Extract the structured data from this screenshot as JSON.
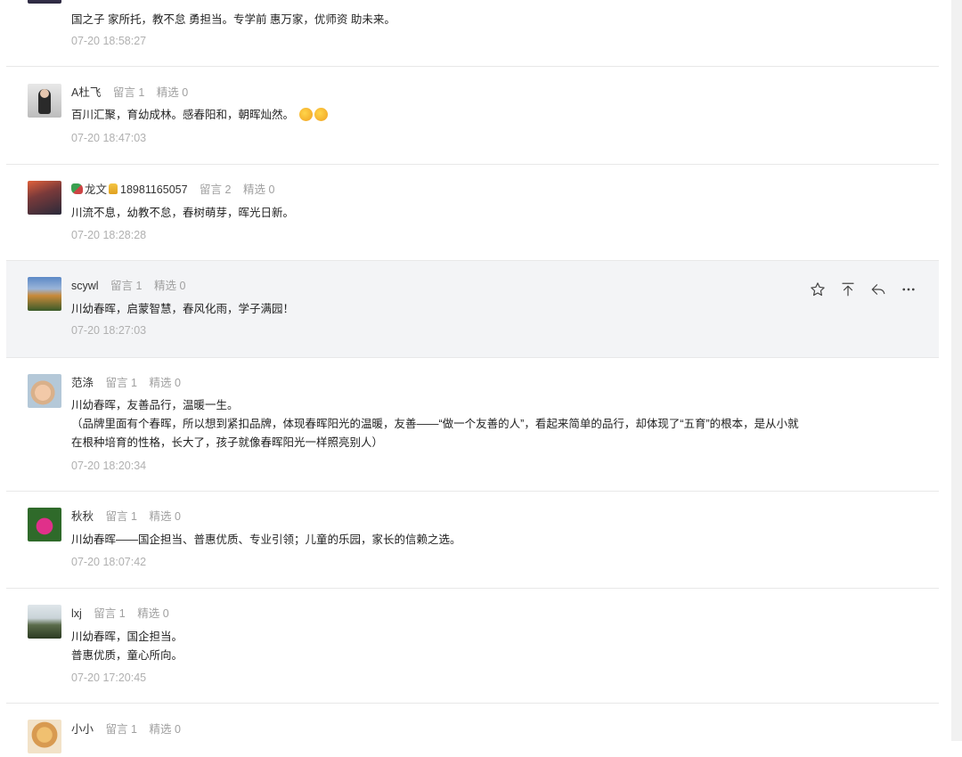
{
  "labels": {
    "reply": "留言",
    "selected": "精选"
  },
  "comments": [
    {
      "name": "",
      "replies": "",
      "selected": "",
      "content": "国之子 家所托，教不怠 勇担当。专学前 惠万家，优师资 助未来。",
      "time": "07-20 18:58:27"
    },
    {
      "name": "A杜飞",
      "replies": "1",
      "selected": "0",
      "content": "百川汇聚，育幼成林。感春阳和，朝晖灿然。",
      "time": "07-20 18:47:03"
    },
    {
      "name_a": "龙文",
      "name_b": "18981165057",
      "replies": "2",
      "selected": "0",
      "content": "川流不息，幼教不怠，春树萌芽，晖光日新。",
      "time": "07-20 18:28:28"
    },
    {
      "name": "scywl",
      "replies": "1",
      "selected": "0",
      "content": "川幼春晖，启蒙智慧，春风化雨，学子满园！",
      "time": "07-20 18:27:03"
    },
    {
      "name": "范涤",
      "replies": "1",
      "selected": "0",
      "content": "川幼春晖，友善品行，温暖一生。",
      "content2": "（品牌里面有个春晖，所以想到紧扣品牌，体现春晖阳光的温暖，友善——“做一个友善的人”，看起来简单的品行，却体现了“五育”的根本，是从小就",
      "content3": "在根种培育的性格，长大了，孩子就像春晖阳光一样照亮别人）",
      "time": "07-20 18:20:34"
    },
    {
      "name": "秋秋",
      "replies": "1",
      "selected": "0",
      "content": "川幼春晖——国企担当、普惠优质、专业引领；儿童的乐园，家长的信赖之选。",
      "time": "07-20 18:07:42"
    },
    {
      "name": "lxj",
      "replies": "1",
      "selected": "0",
      "content": "川幼春晖，国企担当。",
      "content2": "普惠优质，童心所向。",
      "time": "07-20 17:20:45"
    },
    {
      "name": "小小",
      "replies": "1",
      "selected": "0"
    }
  ],
  "colors": {
    "hover_bg": "#f3f4f6",
    "divider": "#e8e8e8",
    "muted": "#a0a0a0"
  }
}
